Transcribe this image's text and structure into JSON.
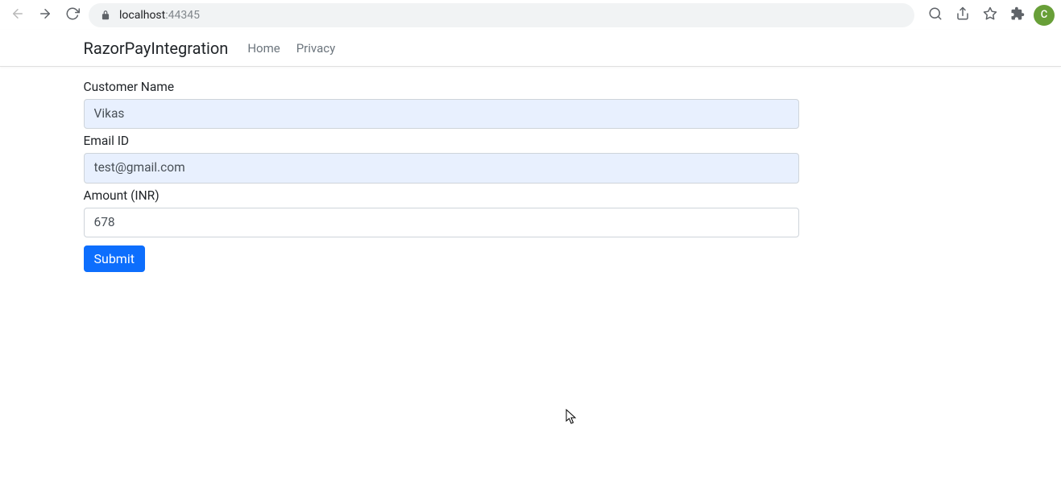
{
  "browser": {
    "url_host": "localhost",
    "url_port": ":44345",
    "avatar_initial": "C"
  },
  "navbar": {
    "brand": "RazorPayIntegration",
    "links": [
      {
        "label": "Home"
      },
      {
        "label": "Privacy"
      }
    ]
  },
  "form": {
    "customer_name": {
      "label": "Customer Name",
      "value": "Vikas"
    },
    "email": {
      "label": "Email ID",
      "value": "test@gmail.com"
    },
    "amount": {
      "label": "Amount (INR)",
      "value": "678"
    },
    "submit_label": "Submit"
  }
}
